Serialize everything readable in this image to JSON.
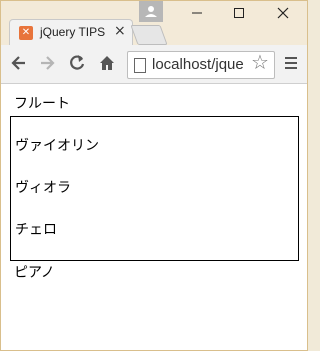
{
  "browser": {
    "tab_title": "jQuery TIPS",
    "tab_favicon_icon": "xampp-icon",
    "address_text": "localhost/jque",
    "window_controls": {
      "minimize": "—",
      "maximize": "☐",
      "close": "✕"
    }
  },
  "page": {
    "items": [
      {
        "label": "フルート"
      },
      {
        "label": "ヴァイオリン"
      },
      {
        "label": "ヴィオラ"
      },
      {
        "label": "チェロ"
      },
      {
        "label": "ピアノ"
      }
    ]
  }
}
